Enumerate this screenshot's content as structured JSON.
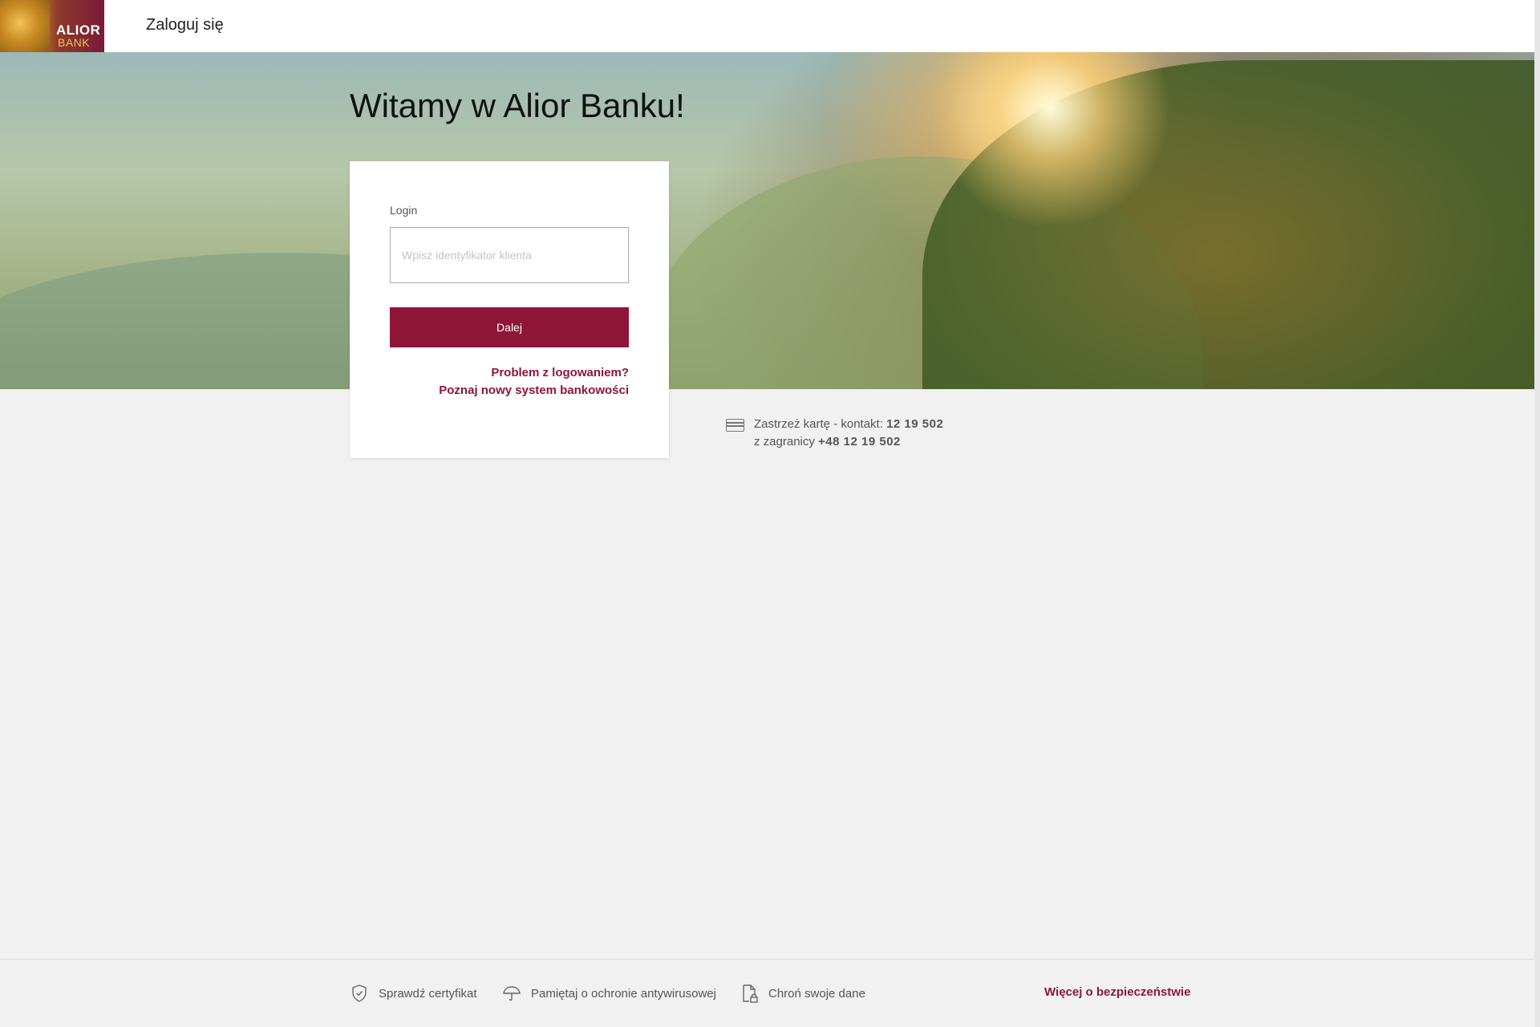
{
  "header": {
    "logo": {
      "word1": "ALIOR",
      "word2": "BANK"
    },
    "title": "Zaloguj się"
  },
  "hero": {
    "heading": "Witamy w Alior Banku!"
  },
  "login": {
    "label": "Login",
    "placeholder": "Wpisz identyfikator klienta",
    "value": "",
    "submit_label": "Dalej",
    "links": {
      "problem": "Problem z logowaniem?",
      "new_system": "Poznaj nowy system bankowości"
    }
  },
  "contact": {
    "line1_text": "Zastrzeż kartę - kontakt: ",
    "line1_number": "12 19 502",
    "line2_text": "z zagranicy ",
    "line2_number": "+48 12 19 502",
    "icon": "card-icon"
  },
  "footer": {
    "items": [
      {
        "label": "Sprawdź certyfikat",
        "icon": "shield-check-icon"
      },
      {
        "label": "Pamiętaj o ochronie antywirusowej",
        "icon": "umbrella-icon"
      },
      {
        "label": "Chroń swoje dane",
        "icon": "document-lock-icon"
      }
    ],
    "more_link": "Więcej o bezpieczeństwie"
  },
  "colors": {
    "accent": "#8e1538",
    "background": "#f1f1f1",
    "card": "#ffffff"
  }
}
